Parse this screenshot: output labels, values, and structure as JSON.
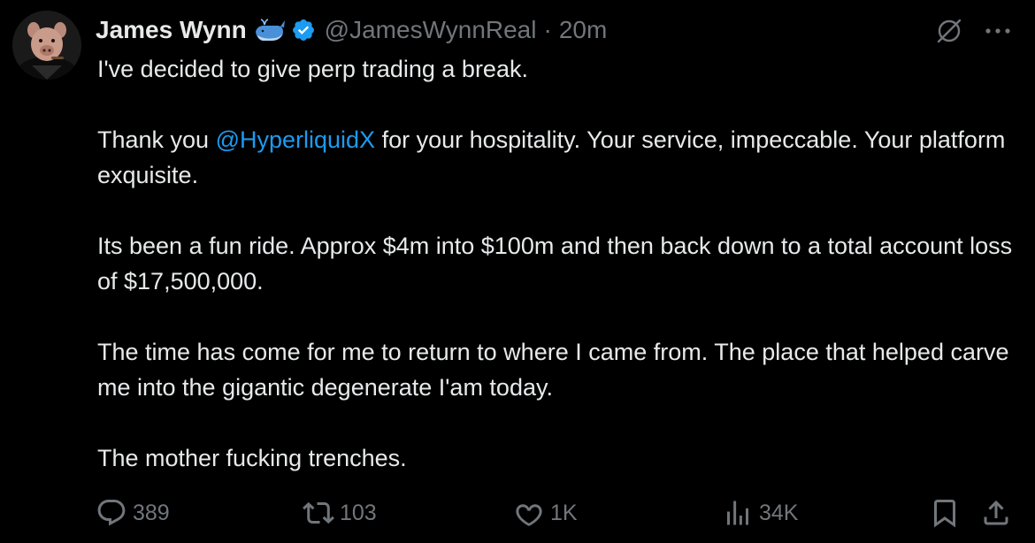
{
  "author": {
    "display_name": "James Wynn",
    "handle": "@JamesWynnReal",
    "separator": "·",
    "time": "20m"
  },
  "body": {
    "p1": "I've decided to give perp trading a break.",
    "p2_before": "Thank you ",
    "p2_mention": "@HyperliquidX",
    "p2_after": " for your hospitality. Your service, impeccable. Your platform exquisite.",
    "p3": "Its been a fun ride. Approx $4m into $100m and then back down to a total account loss of $17,500,000.",
    "p4": "The time has come for me to return to where I came from. The place that helped carve me into the gigantic degenerate I'am today.",
    "p5": "The mother fucking trenches."
  },
  "actions": {
    "reply_count": "389",
    "repost_count": "103",
    "like_count": "1K",
    "views_count": "34K"
  },
  "colors": {
    "background": "#000000",
    "text": "#e7e9ea",
    "muted": "#71767b",
    "accent": "#1d9bf0"
  },
  "icons": [
    "whale-emoji-icon",
    "verified-badge-icon",
    "grok-icon",
    "more-icon",
    "reply-icon",
    "repost-icon",
    "like-icon",
    "views-icon",
    "bookmark-icon",
    "share-icon"
  ]
}
